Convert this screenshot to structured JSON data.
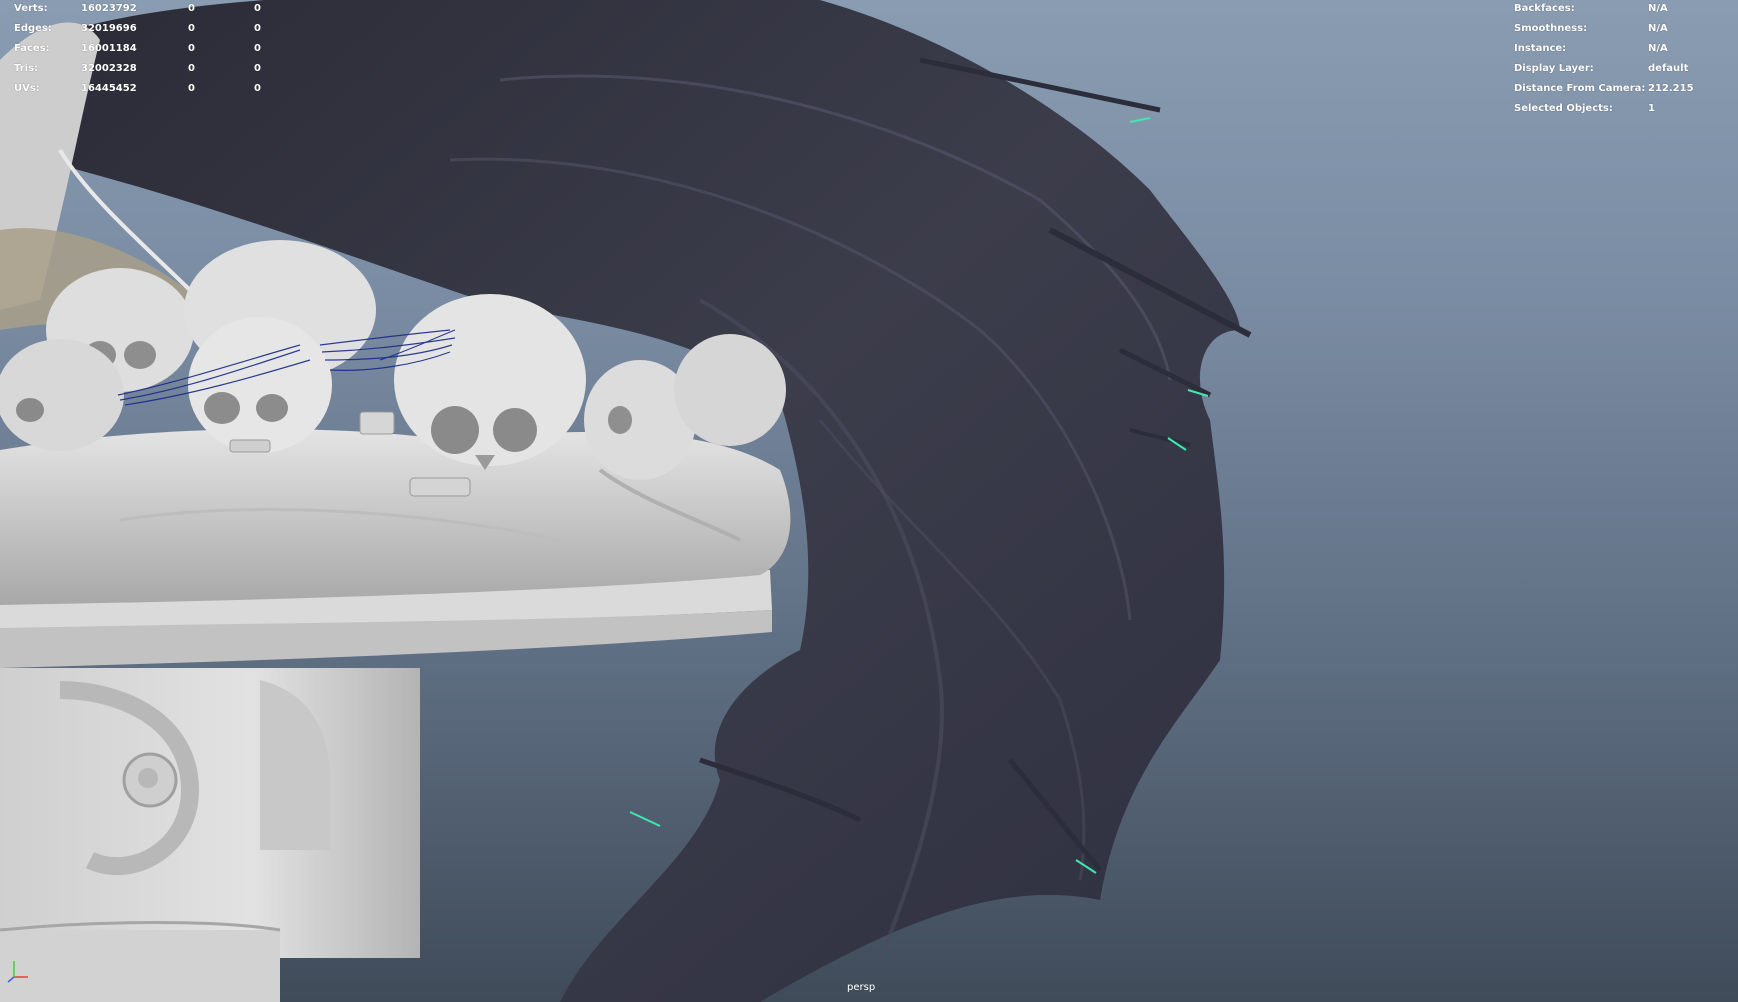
{
  "viewport": {
    "camera_name": "persp",
    "background_top": "#8a9cb2",
    "background_bottom": "#3f4b59"
  },
  "poly_count": {
    "rows": [
      {
        "label": "Verts:",
        "values": [
          "16023792",
          "0",
          "0"
        ]
      },
      {
        "label": "Edges:",
        "values": [
          "32019696",
          "0",
          "0"
        ]
      },
      {
        "label": "Faces:",
        "values": [
          "16001184",
          "0",
          "0"
        ]
      },
      {
        "label": "Tris:",
        "values": [
          "32002328",
          "0",
          "0"
        ]
      },
      {
        "label": "UVs:",
        "values": [
          "16445452",
          "0",
          "0"
        ]
      }
    ]
  },
  "object_details": {
    "rows": [
      {
        "label": "Backfaces:",
        "value": "N/A"
      },
      {
        "label": "Smoothness:",
        "value": "N/A"
      },
      {
        "label": "Instance:",
        "value": "N/A"
      },
      {
        "label": "Display Layer:",
        "value": "default"
      },
      {
        "label": "Distance From Camera:",
        "value": "212.215"
      },
      {
        "label": "Selected Objects:",
        "value": "1"
      }
    ]
  },
  "scene_colors": {
    "wing": "#3a3b47",
    "wing_highlight": "#55576a",
    "sculpt": "#d6d6d6",
    "sculpt_shadow": "#9c9c9c",
    "hair_strands": "#1a2a8a",
    "selection_tips": "#3ee8b0",
    "axis_x": "#e84040",
    "axis_y": "#40d040",
    "axis_z": "#4060e8"
  },
  "icons": {
    "axis_gizmo": "xyz-axis-icon"
  }
}
